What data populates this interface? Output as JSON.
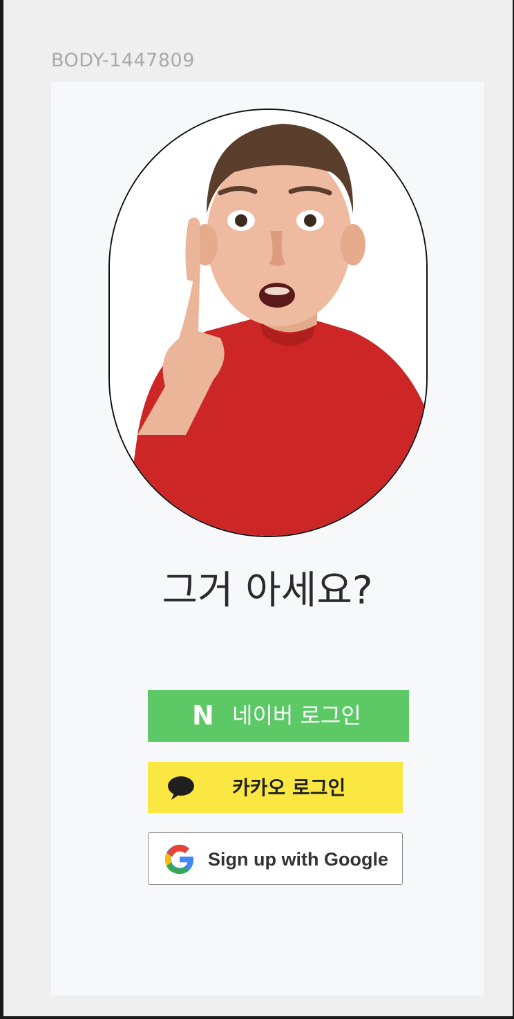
{
  "frame": {
    "label": "BODY-1447809"
  },
  "card": {
    "headline": "그거 아세요?",
    "photo": {
      "alt": "surprised boy in red shirt pointing up"
    }
  },
  "buttons": {
    "naver": {
      "logo": "N",
      "label": "네이버 로그인",
      "color": "#5cc866"
    },
    "kakao": {
      "label": "카카오 로그인",
      "icon": "speech-bubble-icon",
      "color": "#fae741"
    },
    "google": {
      "label": "Sign up with Google",
      "icon": "google-g-icon"
    }
  }
}
